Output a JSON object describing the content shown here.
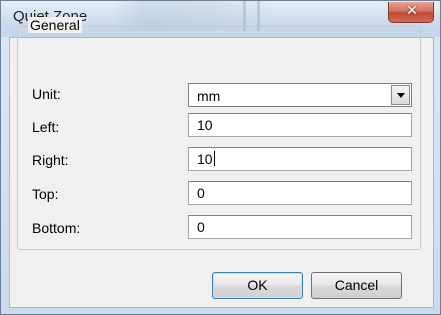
{
  "window": {
    "title": "Quiet Zone",
    "close_icon": "close-icon"
  },
  "general_group": {
    "legend": "General",
    "unit": {
      "label": "Unit:",
      "value": "mm",
      "icon": "chevron-down-icon"
    },
    "left": {
      "label": "Left:",
      "value": "10"
    },
    "right": {
      "label": "Right:",
      "value": "10"
    },
    "top": {
      "label": "Top:",
      "value": "0"
    },
    "bottom": {
      "label": "Bottom:",
      "value": "0"
    }
  },
  "buttons": {
    "ok_label": "OK",
    "cancel_label": "Cancel"
  },
  "colors": {
    "close_button": "#c04b37",
    "default_button_border": "#3c7fb1",
    "dialog_background": "#f0f0f0"
  }
}
